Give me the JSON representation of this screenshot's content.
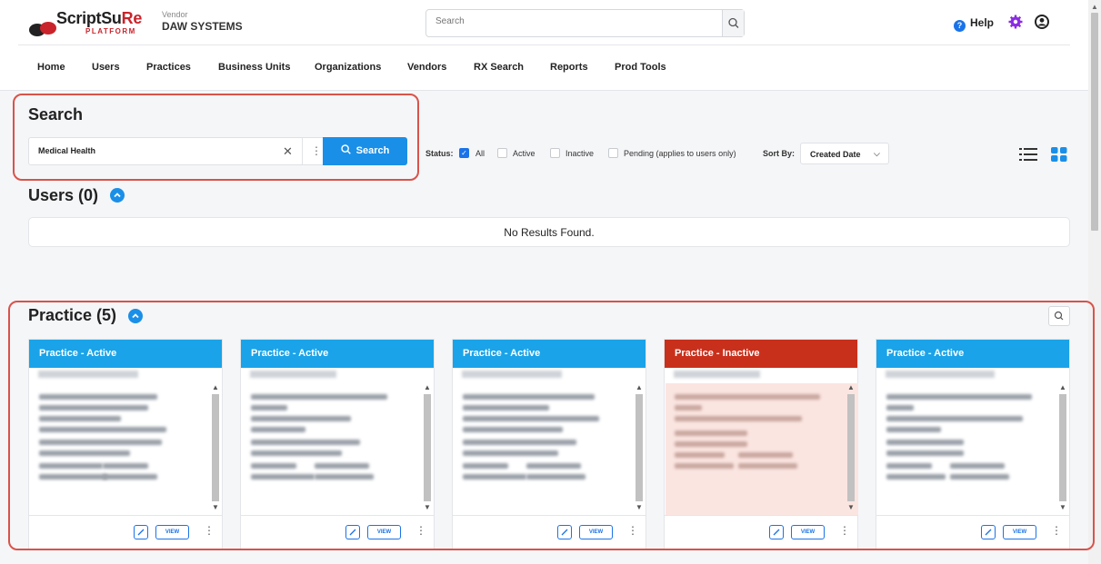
{
  "header": {
    "logo_text_prefix": "ScriptSu",
    "logo_text_accent": "Re",
    "logo_sub": "PLATFORM",
    "vendor_label": "Vendor",
    "vendor_value": "DAW SYSTEMS",
    "search_placeholder": "Search",
    "help_label": "Help"
  },
  "nav": [
    "Home",
    "Users",
    "Practices",
    "Business Units",
    "Organizations",
    "Vendors",
    "RX Search",
    "Reports",
    "Prod Tools"
  ],
  "search": {
    "title": "Search",
    "value": "Medical Health",
    "button_label": "Search",
    "status_label": "Status:",
    "filters": [
      "All",
      "Active",
      "Inactive",
      "Pending (applies to users only)"
    ],
    "sort_label": "Sort By:",
    "sort_value": "Created Date"
  },
  "users": {
    "title": "Users (0)",
    "empty_text": "No Results Found."
  },
  "practice": {
    "title": "Practice (5)",
    "cards": [
      {
        "status": "Practice - Active",
        "state": "active",
        "view_label": "VIEW"
      },
      {
        "status": "Practice - Active",
        "state": "active",
        "view_label": "VIEW"
      },
      {
        "status": "Practice - Active",
        "state": "active",
        "view_label": "VIEW"
      },
      {
        "status": "Practice - Inactive",
        "state": "inactive",
        "view_label": "VIEW"
      },
      {
        "status": "Practice - Active",
        "state": "active",
        "view_label": "VIEW"
      }
    ]
  },
  "colors": {
    "accent": "#1a8fe8",
    "active_header": "#1aa3e8",
    "inactive_header": "#c9301c",
    "highlight_box": "#d9534a"
  }
}
